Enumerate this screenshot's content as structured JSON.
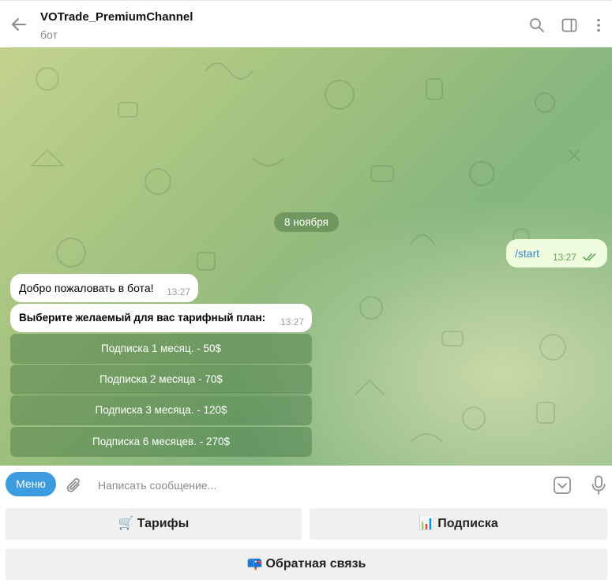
{
  "header": {
    "title": "VOTrade_PremiumChannel",
    "subtitle": "бот"
  },
  "chat": {
    "date_label": "8 ноября",
    "outgoing": {
      "text": "/start",
      "time": "13:27"
    },
    "incoming": [
      {
        "text": "Добро пожаловать в бота!",
        "time": "13:27",
        "bold": false
      },
      {
        "text": "Выберите желаемый для вас тарифный план:",
        "time": "13:27",
        "bold": true
      }
    ],
    "inline_buttons": [
      "Подписка 1 месяц. - 50$",
      "Подписка 2 месяца - 70$",
      "Подписка 3 месяца. - 120$",
      "Подписка 6 месяцев. - 270$"
    ]
  },
  "composer": {
    "menu_label": "Меню",
    "placeholder": "Написать сообщение..."
  },
  "reply_keyboard": {
    "tariffs": {
      "emoji": "🛒",
      "label": "Тарифы"
    },
    "subscription": {
      "emoji": "📊",
      "label": "Подписка"
    },
    "feedback": {
      "emoji": "📪",
      "label": "Обратная связь"
    }
  },
  "colors": {
    "accent": "#3d9be0",
    "outgoing_bubble": "#effdde",
    "chat_bg": "#9fc07e"
  },
  "icons": [
    "back-arrow-icon",
    "search-icon",
    "sidebar-toggle-icon",
    "more-vertical-icon",
    "paperclip-icon",
    "bot-commands-icon",
    "microphone-icon",
    "double-check-icon"
  ]
}
